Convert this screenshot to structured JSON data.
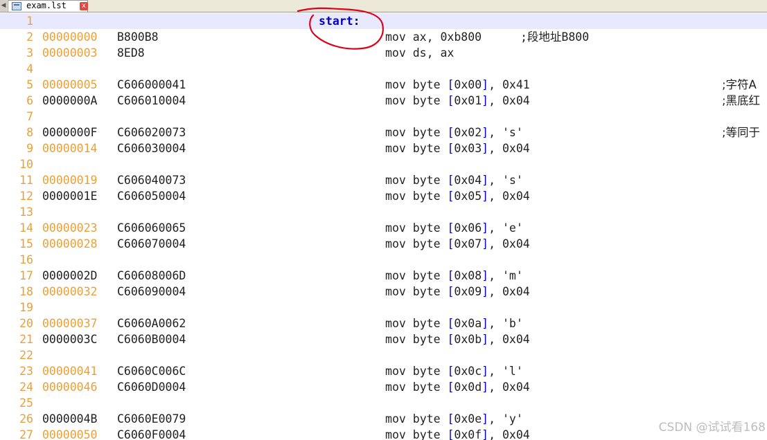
{
  "tab": {
    "title": "exam.lst",
    "close_glyph": "x"
  },
  "label": "start:",
  "rows": [
    {
      "ln": "1",
      "addr": "",
      "code": "",
      "instr": "",
      "comment": ""
    },
    {
      "ln": "2",
      "addr": "00000000",
      "code": "B800B8",
      "instr": "mov ax, 0xb800",
      "comment": ";段地址B800"
    },
    {
      "ln": "3",
      "addr": "00000003",
      "code": "8ED8",
      "instr": "mov ds, ax",
      "comment": ""
    },
    {
      "ln": "4",
      "addr": "",
      "code": "",
      "instr": "",
      "comment": ""
    },
    {
      "ln": "5",
      "addr": "00000005",
      "code": "C606000041",
      "instr": "mov byte [0x00], 0x41",
      "comment": ";字符A"
    },
    {
      "ln": "6",
      "addr": "0000000A",
      "code": "C606010004",
      "instr": "mov byte [0x01], 0x04",
      "comment": ";黑底红"
    },
    {
      "ln": "7",
      "addr": "",
      "code": "",
      "instr": "",
      "comment": ""
    },
    {
      "ln": "8",
      "addr": "0000000F",
      "code": "C606020073",
      "instr": "mov byte [0x02], 's'",
      "comment": ";等同于"
    },
    {
      "ln": "9",
      "addr": "00000014",
      "code": "C606030004",
      "instr": "mov byte [0x03], 0x04",
      "comment": ""
    },
    {
      "ln": "10",
      "addr": "",
      "code": "",
      "instr": "",
      "comment": ""
    },
    {
      "ln": "11",
      "addr": "00000019",
      "code": "C606040073",
      "instr": "mov byte [0x04], 's'",
      "comment": ""
    },
    {
      "ln": "12",
      "addr": "0000001E",
      "code": "C606050004",
      "instr": "mov byte [0x05], 0x04",
      "comment": ""
    },
    {
      "ln": "13",
      "addr": "",
      "code": "",
      "instr": "",
      "comment": ""
    },
    {
      "ln": "14",
      "addr": "00000023",
      "code": "C606060065",
      "instr": "mov byte [0x06], 'e'",
      "comment": ""
    },
    {
      "ln": "15",
      "addr": "00000028",
      "code": "C606070004",
      "instr": "mov byte [0x07], 0x04",
      "comment": ""
    },
    {
      "ln": "16",
      "addr": "",
      "code": "",
      "instr": "",
      "comment": ""
    },
    {
      "ln": "17",
      "addr": "0000002D",
      "code": "C60608006D",
      "instr": "mov byte [0x08], 'm'",
      "comment": ""
    },
    {
      "ln": "18",
      "addr": "00000032",
      "code": "C606090004",
      "instr": "mov byte [0x09], 0x04",
      "comment": ""
    },
    {
      "ln": "19",
      "addr": "",
      "code": "",
      "instr": "",
      "comment": ""
    },
    {
      "ln": "20",
      "addr": "00000037",
      "code": "C6060A0062",
      "instr": "mov byte [0x0a], 'b'",
      "comment": ""
    },
    {
      "ln": "21",
      "addr": "0000003C",
      "code": "C6060B0004",
      "instr": "mov byte [0x0b], 0x04",
      "comment": ""
    },
    {
      "ln": "22",
      "addr": "",
      "code": "",
      "instr": "",
      "comment": ""
    },
    {
      "ln": "23",
      "addr": "00000041",
      "code": "C6060C006C",
      "instr": "mov byte [0x0c], 'l'",
      "comment": ""
    },
    {
      "ln": "24",
      "addr": "00000046",
      "code": "C6060D0004",
      "instr": "mov byte [0x0d], 0x04",
      "comment": ""
    },
    {
      "ln": "25",
      "addr": "",
      "code": "",
      "instr": "",
      "comment": ""
    },
    {
      "ln": "26",
      "addr": "0000004B",
      "code": "C6060E0079",
      "instr": "mov byte [0x0e], 'y'",
      "comment": ""
    },
    {
      "ln": "27",
      "addr": "00000050",
      "code": "C6060F0004",
      "instr": "mov byte [0x0f], 0x04",
      "comment": ""
    }
  ],
  "orange_address_rows": [
    "2",
    "3",
    "5",
    "9",
    "11",
    "14",
    "15",
    "18",
    "20",
    "23",
    "24",
    "27"
  ],
  "colors": {
    "line_number": "#e8a13a",
    "current_line_bg": "#e8e8ff",
    "label": "#0000cc",
    "bracket": "#0000cc",
    "annotation_red": "#e0001a"
  },
  "watermark": "CSDN @试试看168"
}
